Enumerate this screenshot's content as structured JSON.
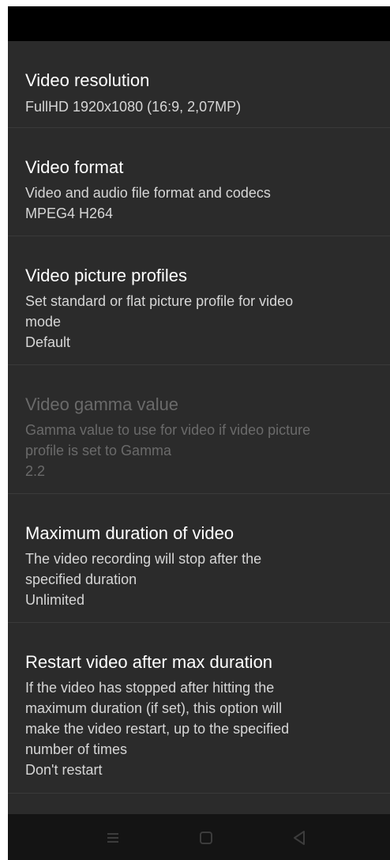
{
  "settings": {
    "items": [
      {
        "title": "Video resolution",
        "summary": "FullHD 1920x1080 (16:9, 2,07MP)",
        "enabled": true
      },
      {
        "title": "Video format",
        "summary": "Video and audio file format and codecs\nMPEG4 H264",
        "enabled": true
      },
      {
        "title": "Video picture profiles",
        "summary": "Set standard or flat picture profile for video\nmode\nDefault",
        "enabled": true
      },
      {
        "title": "Video gamma value",
        "summary": "Gamma value to use for video if video picture\nprofile is set to Gamma\n2.2",
        "enabled": false
      },
      {
        "title": "Maximum duration of video",
        "summary": "The video recording will stop after the\nspecified duration\nUnlimited",
        "enabled": true
      },
      {
        "title": "Restart video after max duration",
        "summary": "If the video has stopped after hitting the\nmaximum duration (if set), this option will\nmake the video restart, up to the specified\nnumber of times\nDon't restart",
        "enabled": true
      }
    ]
  },
  "navigation": {
    "buttons": [
      "menu-icon",
      "home-icon",
      "back-icon"
    ],
    "icon_color": "#3c3c3c"
  },
  "colors": {
    "background": "#2b2b2b",
    "title": "#ffffff",
    "summary": "#d6d6d6",
    "disabled": "#6a6a6a"
  }
}
